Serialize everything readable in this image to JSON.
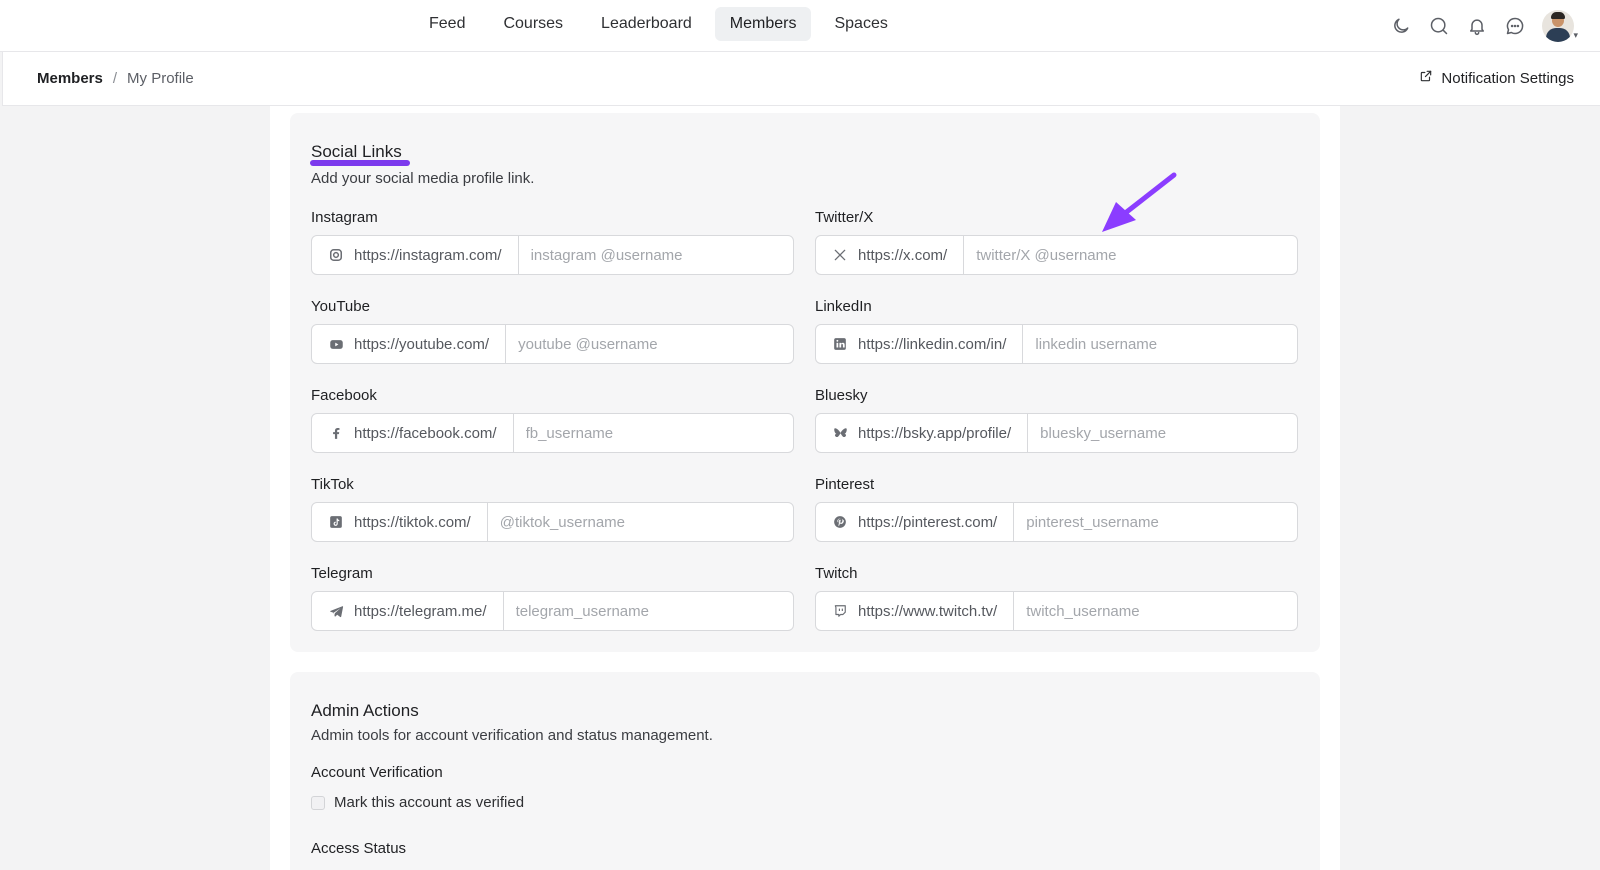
{
  "nav": {
    "links": [
      {
        "label": "Feed",
        "active": false
      },
      {
        "label": "Courses",
        "active": false
      },
      {
        "label": "Leaderboard",
        "active": false
      },
      {
        "label": "Members",
        "active": true
      },
      {
        "label": "Spaces",
        "active": false
      }
    ],
    "icons": [
      "moon-icon",
      "search-icon",
      "bell-icon",
      "chat-icon"
    ]
  },
  "breadcrumb": {
    "root": "Members",
    "separator": "/",
    "current": "My Profile"
  },
  "header_action": {
    "label": "Notification Settings",
    "icon": "external-link-icon"
  },
  "social": {
    "title": "Social Links",
    "description": "Add your social media profile link.",
    "accent": "#7c3aed",
    "fields": [
      {
        "label": "Instagram",
        "prefix": "https://instagram.com/",
        "placeholder": "instagram @username",
        "icon": "instagram-icon"
      },
      {
        "label": "Twitter/X",
        "prefix": "https://x.com/",
        "placeholder": "twitter/X @username",
        "icon": "x-icon"
      },
      {
        "label": "YouTube",
        "prefix": "https://youtube.com/",
        "placeholder": "youtube @username",
        "icon": "youtube-icon"
      },
      {
        "label": "LinkedIn",
        "prefix": "https://linkedin.com/in/",
        "placeholder": "linkedin username",
        "icon": "linkedin-icon"
      },
      {
        "label": "Facebook",
        "prefix": "https://facebook.com/",
        "placeholder": "fb_username",
        "icon": "facebook-icon"
      },
      {
        "label": "Bluesky",
        "prefix": "https://bsky.app/profile/",
        "placeholder": "bluesky_username",
        "icon": "bluesky-icon"
      },
      {
        "label": "TikTok",
        "prefix": "https://tiktok.com/",
        "placeholder": "@tiktok_username",
        "icon": "tiktok-icon"
      },
      {
        "label": "Pinterest",
        "prefix": "https://pinterest.com/",
        "placeholder": "pinterest_username",
        "icon": "pinterest-icon"
      },
      {
        "label": "Telegram",
        "prefix": "https://telegram.me/",
        "placeholder": "telegram_username",
        "icon": "telegram-icon"
      },
      {
        "label": "Twitch",
        "prefix": "https://www.twitch.tv/",
        "placeholder": "twitch_username",
        "icon": "twitch-icon"
      }
    ]
  },
  "admin": {
    "title": "Admin Actions",
    "description": "Admin tools for account verification and status management.",
    "verification_label": "Account Verification",
    "verified_checkbox_label": "Mark this account as verified",
    "verified": false,
    "access_status_label": "Access Status"
  }
}
